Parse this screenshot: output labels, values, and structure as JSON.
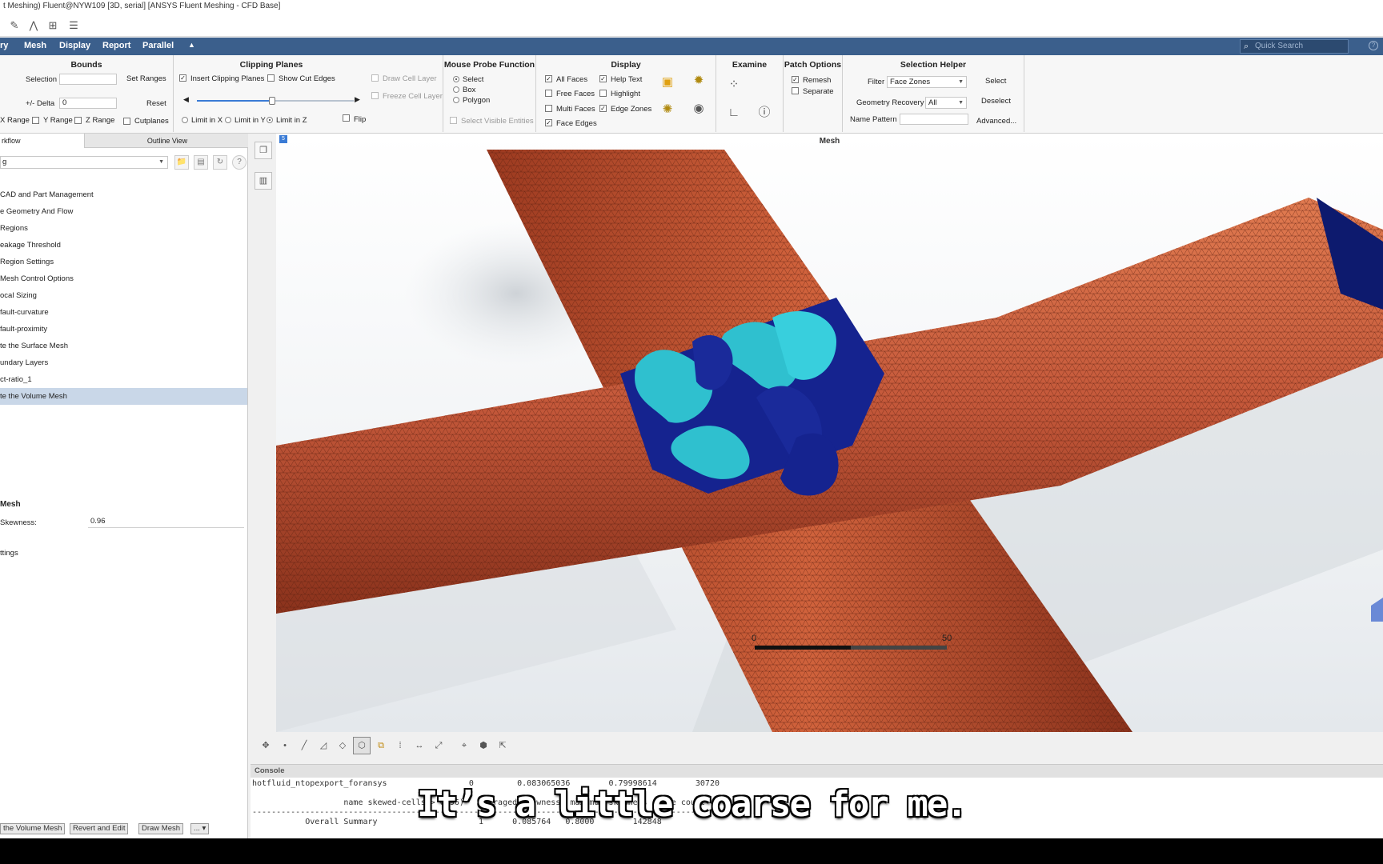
{
  "window": {
    "title": "t Meshing) Fluent@NYW109  [3D, serial] [ANSYS Fluent Meshing - CFD Base]"
  },
  "menu": {
    "items": [
      "ry",
      "Mesh",
      "Display",
      "Report",
      "Parallel"
    ],
    "search_placeholder": "Quick Search"
  },
  "ribbon": {
    "bounds": {
      "title": "Bounds",
      "selection_label": "Selection",
      "set_ranges": "Set Ranges",
      "delta_label": "+/- Delta",
      "delta_value": "0",
      "reset": "Reset",
      "x_range": "X Range",
      "y_range": "Y Range",
      "z_range": "Z Range",
      "cutplanes": "Cutplanes"
    },
    "clipping": {
      "title": "Clipping Planes",
      "insert": "Insert Clipping Planes",
      "show_cut_edges": "Show Cut Edges",
      "draw_cell_layer": "Draw Cell Layer",
      "freeze_cell_layer": "Freeze Cell Layer",
      "limit_x": "Limit in X",
      "limit_y": "Limit in Y",
      "limit_z": "Limit in Z",
      "flip": "Flip",
      "slider_fraction": 0.48
    },
    "probe": {
      "title": "Mouse Probe Function",
      "select": "Select",
      "box": "Box",
      "polygon": "Polygon",
      "select_visible": "Select Visible Entities"
    },
    "display": {
      "title": "Display",
      "all_faces": "All Faces",
      "free_faces": "Free Faces",
      "multi_faces": "Multi Faces",
      "face_edges": "Face Edges",
      "help_text": "Help Text",
      "highlight": "Highlight",
      "edge_zones": "Edge Zones"
    },
    "examine": {
      "title": "Examine"
    },
    "patch": {
      "title": "Patch Options",
      "remesh": "Remesh",
      "separate": "Separate"
    },
    "selection_helper": {
      "title": "Selection Helper",
      "filter_label": "Filter",
      "filter_value": "Face Zones",
      "geom_recovery_label": "Geometry Recovery",
      "geom_recovery_value": "All",
      "name_pattern_label": "Name Pattern",
      "select": "Select",
      "deselect": "Deselect",
      "advanced": "Advanced..."
    }
  },
  "left_panel": {
    "tabs": [
      "rkflow",
      "Outline View"
    ],
    "workflow_value": "g",
    "tree": [
      "CAD and Part Management",
      "e Geometry And Flow",
      " Regions",
      "eakage Threshold",
      " Region Settings",
      " Mesh Control Options",
      "ocal Sizing",
      "fault-curvature",
      "fault-proximity",
      "te the Surface Mesh",
      "undary Layers",
      "ct-ratio_1",
      "te the Volume Mesh"
    ],
    "selected_index": 12,
    "section_title": " Mesh",
    "skewness_label": "Skewness:",
    "skewness_value": "0.96",
    "settings_label": "ttings",
    "buttons": [
      "the Volume Mesh",
      "Revert and Edit",
      "Draw Mesh",
      "... ▾"
    ]
  },
  "viewport": {
    "title": "Mesh",
    "badge": "5",
    "scale_start": "0",
    "scale_end": "50",
    "colors": {
      "surface": "#b54a2a",
      "surface_light": "#e0784f",
      "inner_dark": "#1a2a9a",
      "inner_light": "#2fc0cf"
    }
  },
  "console": {
    "title": "Console",
    "lines": [
      "hotfluid_ntopexport_foransys                 0         0.083065036        0.79998614        30720",
      "                   name skewed-cells(> 0.96)   averaged-skewness  maximum-skewness  face count",
      "---------------------------------------------------------------------------------------------",
      "           Overall Summary                     1      0.085764   0.8000        142848"
    ]
  },
  "subtitle": "It’s a little coarse for me."
}
